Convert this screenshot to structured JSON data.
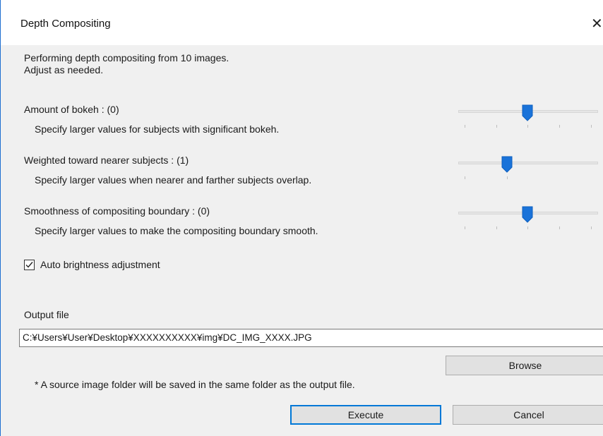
{
  "window": {
    "title": "Depth Compositing",
    "close_glyph": "✕"
  },
  "intro": {
    "line1": "Performing depth compositing from 10 images.",
    "line2": "Adjust as needed."
  },
  "settings": [
    {
      "label": "Amount of bokeh : (0)",
      "description": "Specify larger values for subjects with significant bokeh.",
      "value": 0
    },
    {
      "label": "Weighted toward nearer subjects : (1)",
      "description": "Specify larger values when nearer and farther subjects overlap.",
      "value": 1
    },
    {
      "label": "Smoothness of compositing boundary : (0)",
      "description": "Specify larger values to make the compositing boundary smooth.",
      "value": 0
    }
  ],
  "auto_brightness": {
    "label": "Auto brightness adjustment",
    "checked": true
  },
  "output": {
    "label": "Output file",
    "path": "C:¥Users¥User¥Desktop¥XXXXXXXXXX¥img¥DC_IMG_XXXX.JPG",
    "browse_label": "Browse",
    "note": "* A source image folder will be saved in the same folder as the output file."
  },
  "buttons": {
    "execute": "Execute",
    "cancel": "Cancel"
  },
  "colors": {
    "accent": "#0078d7",
    "slider_thumb": "#1a73d9"
  }
}
